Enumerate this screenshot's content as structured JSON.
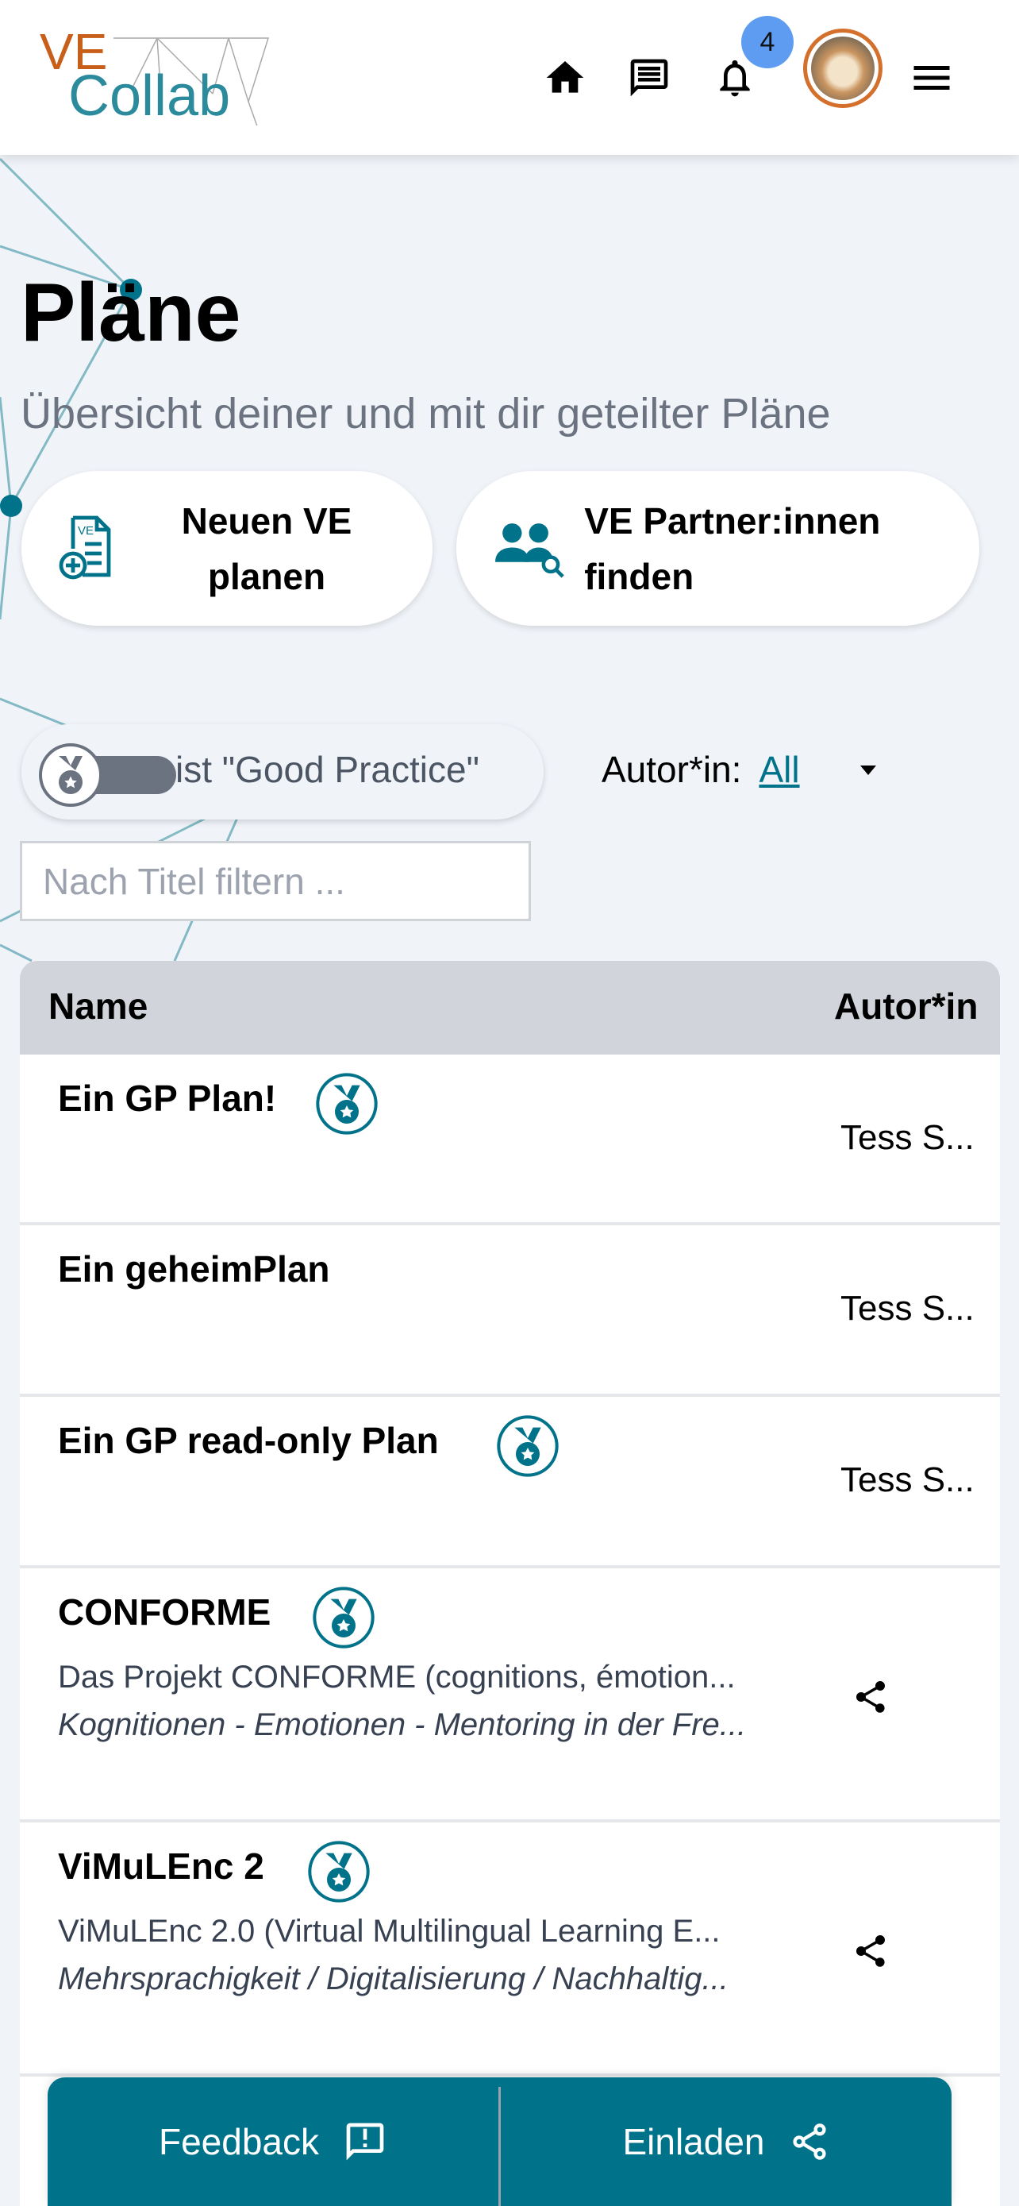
{
  "header": {
    "logo_top": "VE",
    "logo_bottom": "Collab",
    "notification_count": "4",
    "icons": [
      "home-icon",
      "chat-icon",
      "bell-icon",
      "avatar",
      "menu-icon"
    ]
  },
  "page": {
    "title": "Pläne",
    "subtitle": "Übersicht deiner und mit dir geteilter Pläne"
  },
  "actions": {
    "new_plan": "Neuen VE planen",
    "find_partners": "VE Partner:innen finden"
  },
  "filters": {
    "good_practice_label": "ist \"Good Practice\"",
    "good_practice_on": false,
    "author_label": "Autor*in:",
    "author_value": "All",
    "title_placeholder": "Nach Titel filtern ..."
  },
  "table": {
    "columns": [
      "Name",
      "Autor*in"
    ],
    "rows": [
      {
        "name": "Ein GP Plan!",
        "good_practice": true,
        "author": "Tess S..."
      },
      {
        "name": "Ein geheimPlan",
        "good_practice": false,
        "author": "Tess S..."
      },
      {
        "name": "Ein GP read-only Plan",
        "good_practice": true,
        "author": "Tess S..."
      },
      {
        "name": "CONFORME",
        "good_practice": true,
        "description": "Das Projekt CONFORME (cognitions, émotion...",
        "tags": "Kognitionen - Emotionen - Mentoring in der Fre...",
        "shared": true
      },
      {
        "name": "ViMuLEnc 2",
        "good_practice": true,
        "description": "ViMuLEnc 2.0 (Virtual Multilingual Learning E...",
        "tags": "Mehrsprachigkeit / Digitalisierung / Nachhaltig...",
        "shared": true
      }
    ]
  },
  "bottom_bar": {
    "feedback": "Feedback",
    "invite": "Einladen"
  },
  "colors": {
    "accent": "#00728a",
    "logo_orange": "#c75f1a",
    "badge": "#5e9cf2",
    "background": "#f0f4f9"
  }
}
